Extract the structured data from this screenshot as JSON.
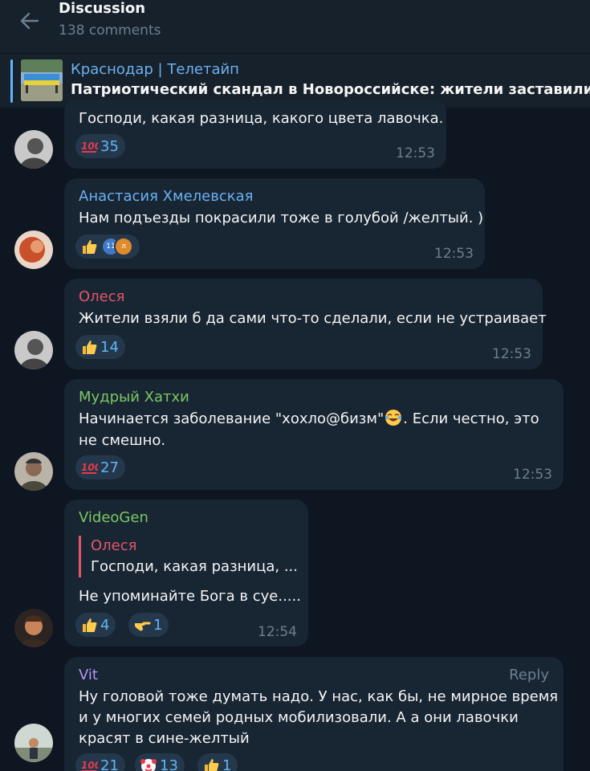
{
  "header": {
    "title": "Discussion",
    "subtitle": "138 comments"
  },
  "pinned": {
    "channel": "Краснодар | Телетайп",
    "text": "Патриотический скандал в Новороссийске: жители заставили влас"
  },
  "messages": [
    {
      "author": "",
      "text": [
        "Господи, какая разница, какого цвета лавочка."
      ],
      "time": "12:53",
      "reactions": [
        {
          "emoji": "hundred-points",
          "count": "35"
        }
      ]
    },
    {
      "author": "Анастасия Хмелевская",
      "author_color": "#6ab2f2",
      "text": [
        "Нам подъезды покрасили тоже в голубой /желтый. )"
      ],
      "time": "12:53",
      "reactions": [
        {
          "emoji": "thumbs-up",
          "count": "",
          "mini_avatars": [
            "11",
            "л"
          ]
        }
      ]
    },
    {
      "author": "Олеся",
      "author_color": "#e5566a",
      "text": [
        "Жители взяли б да сами что-то сделали, если не устраивает"
      ],
      "time": "12:53",
      "reactions": [
        {
          "emoji": "thumbs-up",
          "count": "14"
        }
      ]
    },
    {
      "author": "Мудрый Хатхи",
      "author_color": "#7bc862",
      "text": [
        "Начинается заболевание \"хохло@бизм\"",
        ". Если честно, это",
        "не смешно."
      ],
      "time": "12:53",
      "reactions": [
        {
          "emoji": "hundred-points",
          "count": "27"
        }
      ]
    },
    {
      "author": "VideoGen",
      "author_color": "#7bc862",
      "reply_to": {
        "author": "Олеся",
        "text": "Господи, какая разница, ..."
      },
      "text": [
        "Не упоминайте Бога в суе....."
      ],
      "time": "12:54",
      "reactions": [
        {
          "emoji": "thumbs-up",
          "count": "4"
        },
        {
          "emoji": "pointing-hand",
          "count": "1"
        }
      ]
    },
    {
      "author": "Vit",
      "author_color": "#b694f9",
      "reply_label": "Reply",
      "text": [
        "Ну головой тоже думать надо. У нас, как бы, не мирное время",
        "и у многих семей родных мобилизовали. А а они лавочки",
        "красят в сине-желтый"
      ],
      "time": "",
      "reactions": [
        {
          "emoji": "hundred-points",
          "count": "21"
        },
        {
          "emoji": "clown-face",
          "count": "13"
        },
        {
          "emoji": "thumbs-up",
          "count": "1"
        }
      ]
    }
  ],
  "colors": {
    "background": "#0e1621",
    "header": "#17212b",
    "bubble": "#182533",
    "reaction_pill": "#25384b",
    "accent": "#5eb5f7",
    "muted": "#6d7f8f"
  }
}
